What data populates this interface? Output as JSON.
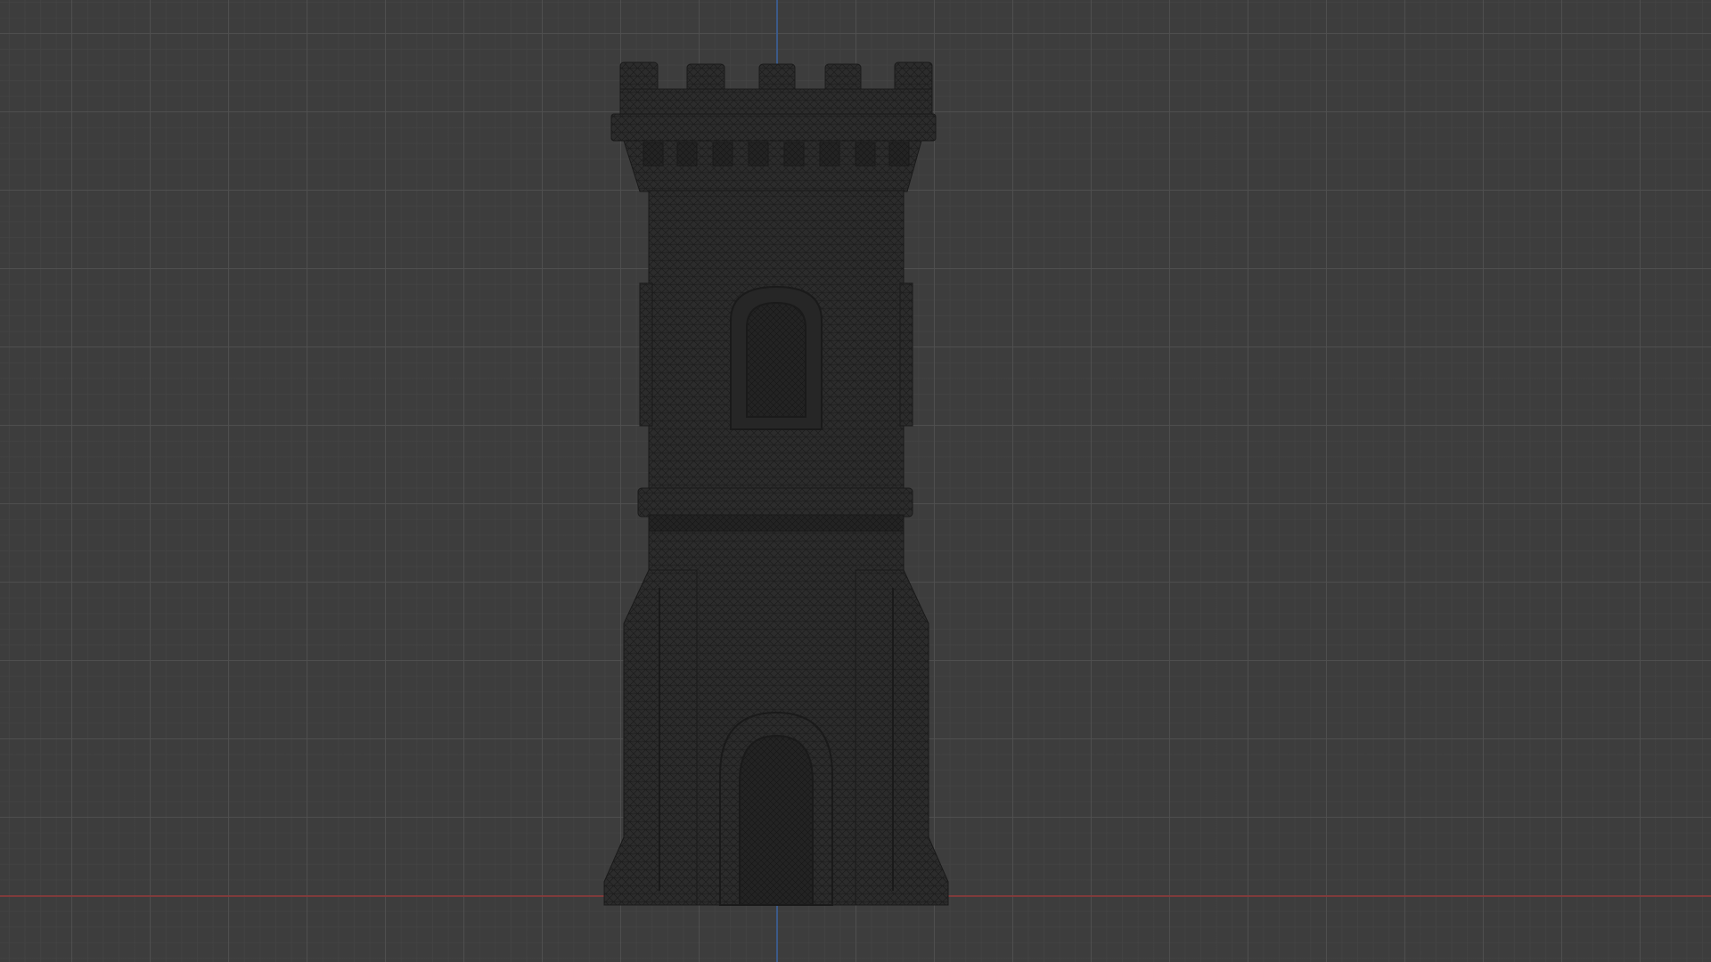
{
  "viewport": {
    "background_color": "#3d3d3d",
    "grid_color": "#505050",
    "axis_x_color": "#8a3a3a",
    "axis_y_color": "#3b5c8f"
  },
  "model": {
    "icon": "castle-tower-wireframe",
    "shading": "wireframe",
    "mesh_color": "#2a2a2a"
  }
}
